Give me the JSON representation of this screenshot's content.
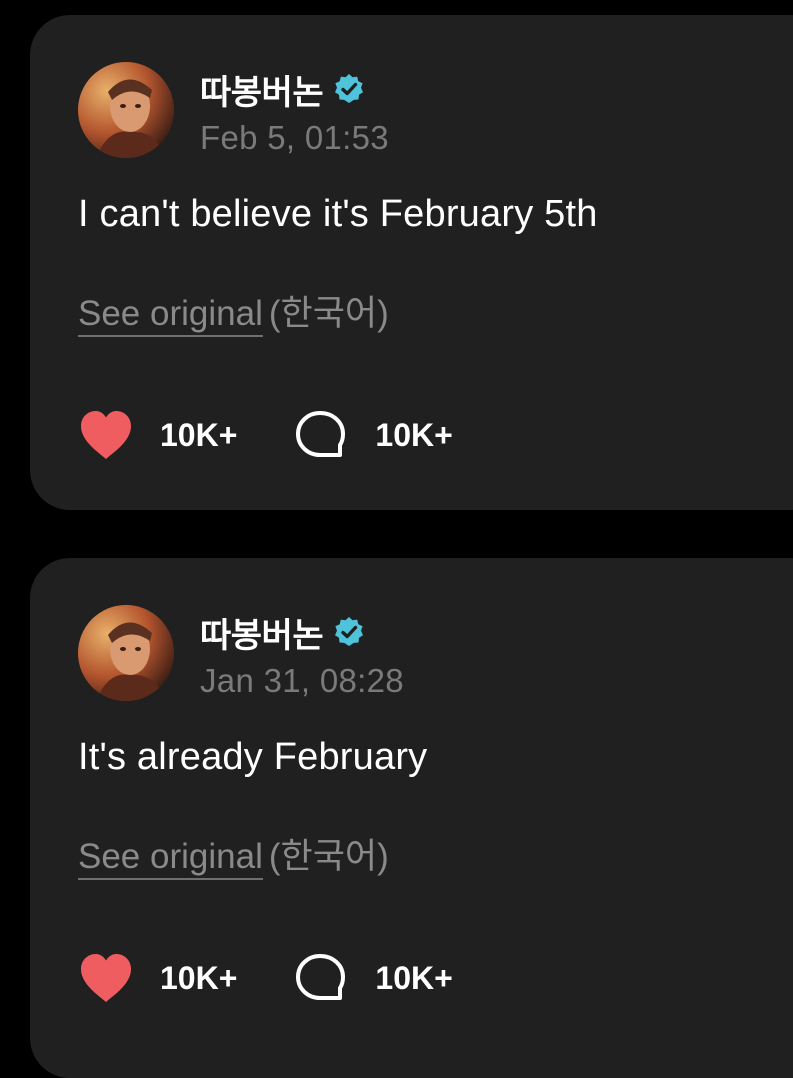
{
  "posts": [
    {
      "author": "따봉버논",
      "timestamp": "Feb 5, 01:53",
      "text": "I can't believe it's February 5th",
      "see_original_label": "See original",
      "language_label": "(한국어)",
      "like_count": "10K+",
      "reply_count": "10K+"
    },
    {
      "author": "따봉버논",
      "timestamp": "Jan 31, 08:28",
      "text": "It's already February",
      "see_original_label": "See original",
      "language_label": "(한국어)",
      "like_count": "10K+",
      "reply_count": "10K+"
    }
  ],
  "icons": {
    "verified": "verified-badge-icon",
    "like": "heart-icon",
    "reply": "speech-bubble-icon"
  },
  "colors": {
    "background": "#000000",
    "card": "#202020",
    "verified": "#4fc3d9",
    "heart": "#f05d61",
    "muted_text": "#7a7a7a"
  }
}
